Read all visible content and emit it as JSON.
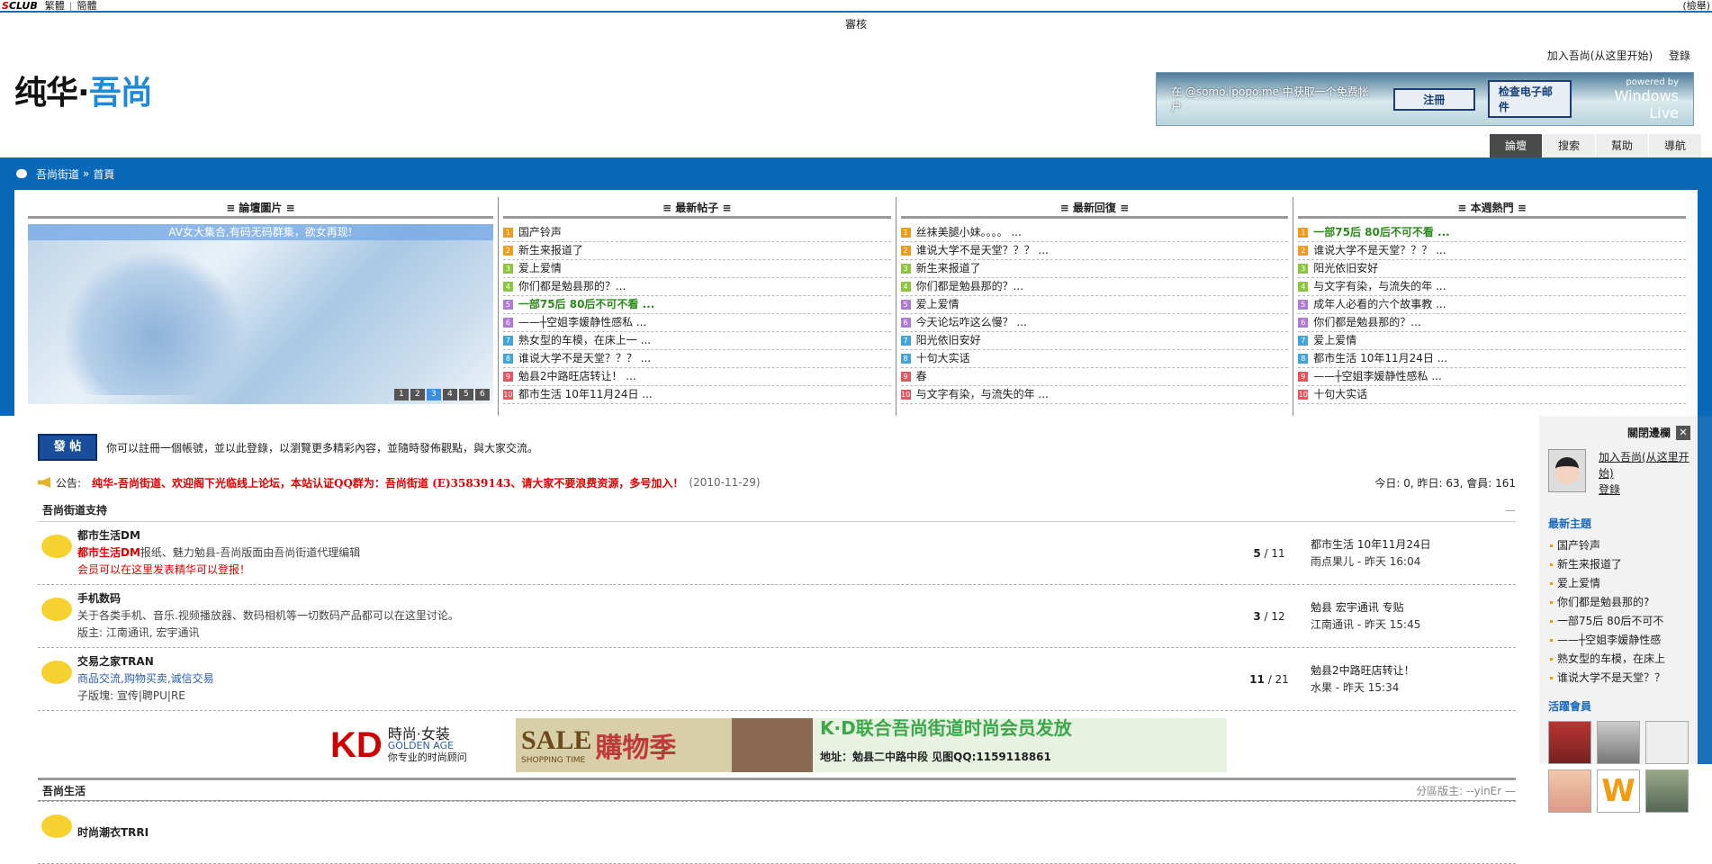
{
  "topbar": {
    "logo_prefix": "S",
    "logo_rest": "CLUB",
    "lang_trad": "繁體",
    "lang_simp": "簡體",
    "right_text": "(檢舉)"
  },
  "review_label": "審核",
  "site": {
    "logo_a": "纯华·",
    "logo_b": "吾尚"
  },
  "header_links": {
    "join": "加入吾尚(从这里开始)",
    "login": "登錄"
  },
  "windows_live": {
    "prompt": "在 @somo.ipopo.me 中获取一个免费帐户",
    "register": "注冊",
    "check_mail": "检查电子邮件",
    "powered": "powered by",
    "brand": "Windows Live"
  },
  "nav_tabs": [
    {
      "label": "論壇"
    },
    {
      "label": "搜索"
    },
    {
      "label": "幫助"
    },
    {
      "label": "導航"
    }
  ],
  "breadcrumb": {
    "home": "吾尚街道",
    "sep": "»",
    "current": "首頁"
  },
  "panels": {
    "images": {
      "title": "≡ 論壇圖片 ≡",
      "caption": "AV女大集合,有码无码群集，欲女再现!",
      "pages": [
        "1",
        "2",
        "3",
        "4",
        "5",
        "6"
      ]
    },
    "latest_posts": {
      "title": "≡ 最新帖子 ≡",
      "items": [
        "国产铃声",
        "新生来报道了",
        "爱上爱情",
        "你们都是勉县那的？...",
        "一部75后 80后不可不看 ...",
        "——┼空姐李媛静性感私 ...",
        "熟女型的车模，在床上一 ...",
        "谁说大学不是天堂？？？ ...",
        "勉县2中路旺店转让！ ...",
        "都市生活 10年11月24日 ..."
      ]
    },
    "latest_replies": {
      "title": "≡ 最新回復 ≡",
      "items": [
        "丝袜美腿小妹。。。。 ...",
        "谁说大学不是天堂？？？ ...",
        "新生来报道了",
        "你们都是勉县那的？...",
        "爱上爱情",
        "今天论坛咋这么慢？ ...",
        "阳光依旧安好",
        "十句大实话",
        "春",
        "与文字有染，与流失的年 ..."
      ]
    },
    "weekly_hot": {
      "title": "≡ 本週熱門 ≡",
      "items": [
        "一部75后 80后不可不看 ...",
        "谁说大学不是天堂？？？ ...",
        "阳光依旧安好",
        "与文字有染，与流失的年 ...",
        "成年人必看的六个故事教 ...",
        "你们都是勉县那的？...",
        "爱上爱情",
        "都市生活 10年11月24日 ...",
        "——┼空姐李媛静性感私 ...",
        "十句大实话"
      ]
    }
  },
  "postbar": {
    "button": "發 帖",
    "text": "你可以註冊一個帳號，並以此登錄，以瀏覽更多精彩內容，並隨時發佈觀點，與大家交流。"
  },
  "notice": {
    "label": "公告:",
    "message": "纯华-吾尚街道、欢迎阁下光临线上论坛，本站认证QQ群为：吾尚街道 (E)35839143、请大家不要浪费资源，多号加入！",
    "date": "(2010-11-29)",
    "stats": "今日: 0, 昨日: 63, 會員: 161"
  },
  "sections": [
    {
      "title": "吾尚街道支持",
      "extra": "—"
    },
    {
      "title": "吾尚生活",
      "extra": "分區版主: --yinEr —"
    }
  ],
  "forums": [
    {
      "name": "都市生活DM",
      "desc_a": "都市生活DM",
      "desc_b": "报纸、魅力勉县-吾尚版面由吾尚街道代理编辑",
      "desc_2": "会员可以在这里发表精华可以登报！",
      "topics": "5",
      "posts": " / 11",
      "last_title": "都市生活 10年11月24日",
      "last_meta": "雨点果儿 - 昨天 16:04"
    },
    {
      "name": "手机数码",
      "desc_1": "关于各类手机、音乐.视频播放器、数码相机等一切数码产品都可以在这里讨论。",
      "desc_2": "版主: 江南通讯, 宏宇通讯",
      "topics": "3",
      "posts": " / 12",
      "last_title": "勉县 宏宇通讯 专贴",
      "last_meta": "江南通讯 - 昨天 15:45"
    },
    {
      "name": "交易之家TRAN",
      "desc_1": "商品交流,购物买卖,诚信交易",
      "desc_2": "子版塊: 宣传|聘PU|RE",
      "topics": "11",
      "posts": " / 21",
      "last_title": "勉县2中路旺店转让！",
      "last_meta": "水果 - 昨天 15:34"
    },
    {
      "name": "时尚潮衣TRRI"
    }
  ],
  "banner": {
    "kd": "KD",
    "brand_cn": "時尚·女装",
    "golden": "GOLDEN AGE",
    "slogan": "你专业的时尚顾问",
    "sale": "SALE",
    "shopping_cn": "購物季",
    "shopping_en": "SHOPPING TIME",
    "club": "K·D联合吾尚街道时尚会员发放",
    "address": "地址：勉县二中路中段   见图QQ:1159118861"
  },
  "sidebar": {
    "close_label": "關閉邊欄",
    "close_x": "✕",
    "join": "加入吾尚(从这里开始)",
    "login": "登錄",
    "latest_title": "最新主題",
    "latest": [
      "国产铃声",
      "新生来报道了",
      "爱上爱情",
      "你们都是勉县那的?",
      "一部75后 80后不可不",
      "——┼空姐李媛静性感",
      "熟女型的车模，在床上",
      "谁说大学不是天堂？？"
    ],
    "members_title": "活躍會員"
  }
}
